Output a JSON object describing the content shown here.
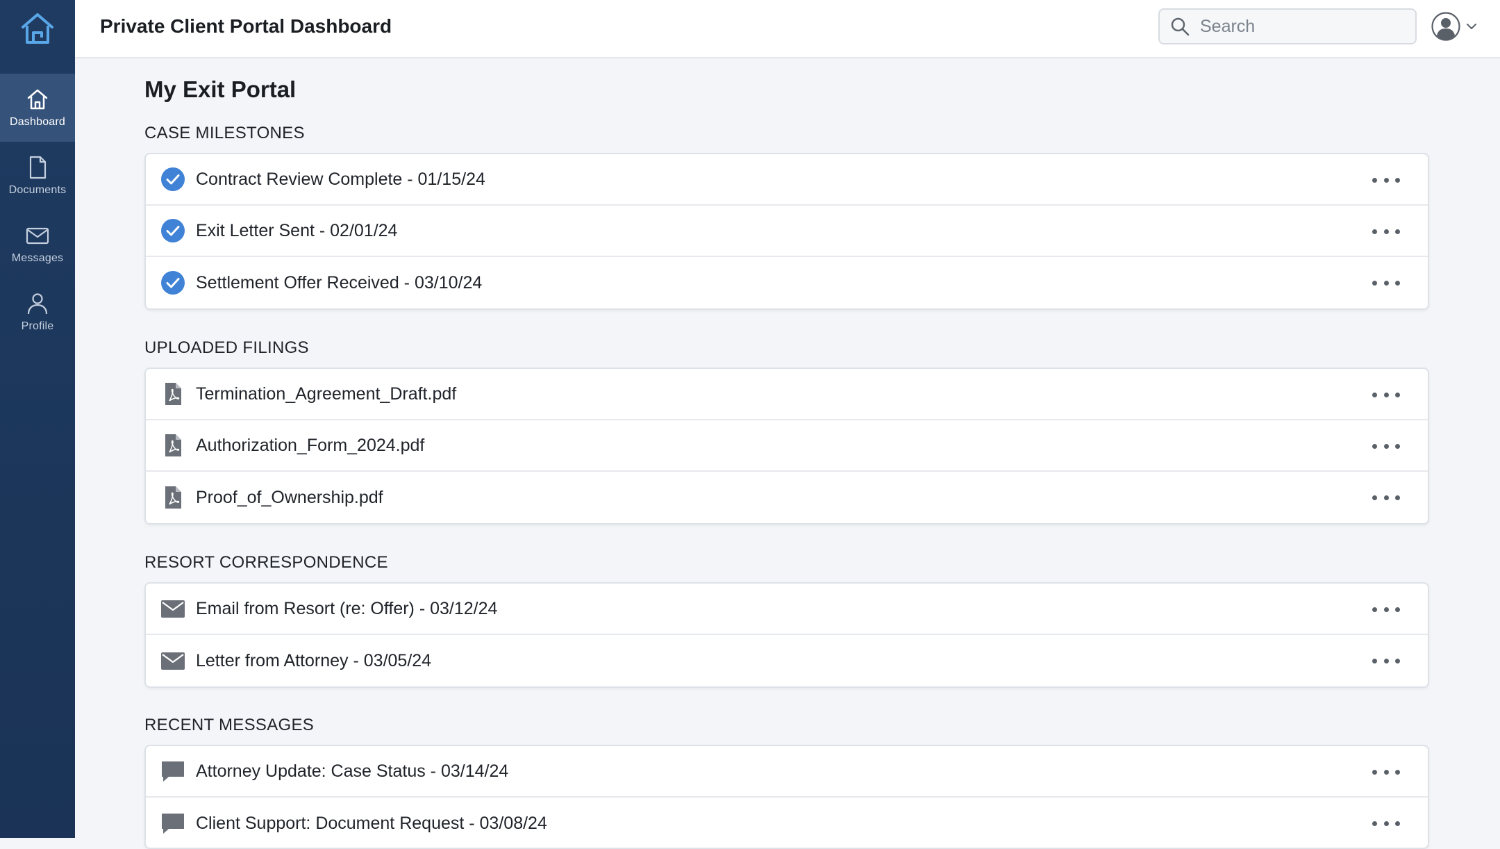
{
  "header": {
    "title": "Private Client Portal Dashboard",
    "search_placeholder": "Search"
  },
  "sidebar": {
    "items": [
      {
        "label": "Dashboard",
        "icon": "home-icon",
        "active": true
      },
      {
        "label": "Documents",
        "icon": "document-icon",
        "active": false
      },
      {
        "label": "Messages",
        "icon": "mail-icon",
        "active": false
      },
      {
        "label": "Profile",
        "icon": "person-icon",
        "active": false
      }
    ]
  },
  "main": {
    "title": "My Exit Portal",
    "sections": [
      {
        "title": "CASE MILESTONES",
        "icon": "check-circle-icon",
        "items": [
          "Contract Review Complete - 01/15/24",
          "Exit Letter Sent - 02/01/24",
          "Settlement Offer Received - 03/10/24"
        ]
      },
      {
        "title": "UPLOADED FILINGS",
        "icon": "pdf-file-icon",
        "items": [
          "Termination_Agreement_Draft.pdf",
          "Authorization_Form_2024.pdf",
          "Proof_of_Ownership.pdf"
        ]
      },
      {
        "title": "RESORT CORRESPONDENCE",
        "icon": "envelope-icon",
        "items": [
          "Email from Resort (re: Offer) - 03/12/24",
          "Letter from Attorney - 03/05/24"
        ]
      },
      {
        "title": "RECENT MESSAGES",
        "icon": "chat-bubble-icon",
        "items": [
          "Attorney Update: Case Status - 03/14/24",
          "Client Support: Document Request - 03/08/24"
        ]
      }
    ]
  },
  "colors": {
    "sidebar_bg": "#1f3b61",
    "sidebar_active": "#35527a",
    "check_blue": "#3f82d6",
    "background": "#f3f5f8"
  }
}
